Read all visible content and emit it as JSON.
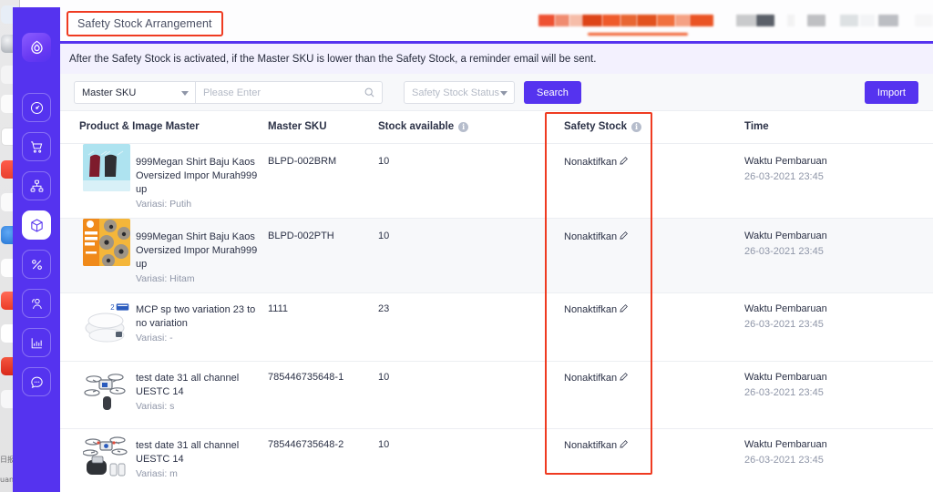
{
  "app": {
    "accent_color": "#5533ef",
    "annotation_color": "#ef3b21",
    "banner_bg": "#f3f1fe"
  },
  "dock": {
    "label_top": "日报",
    "label_bottom": "uan"
  },
  "sidebar": {
    "items": [
      {
        "name": "logo",
        "icon": "leaf-logo-icon",
        "active": false
      },
      {
        "name": "dashboard",
        "icon": "speedometer-icon",
        "active": false
      },
      {
        "name": "orders",
        "icon": "shopping-cart-icon",
        "active": false
      },
      {
        "name": "channels",
        "icon": "sitemap-icon",
        "active": false
      },
      {
        "name": "inventory",
        "icon": "box-icon",
        "active": true
      },
      {
        "name": "promotions",
        "icon": "percent-icon",
        "active": false
      },
      {
        "name": "customers",
        "icon": "users-icon",
        "active": false
      },
      {
        "name": "reports",
        "icon": "bar-chart-icon",
        "active": false
      },
      {
        "name": "messages",
        "icon": "chat-bubble-icon",
        "active": false
      }
    ]
  },
  "header": {
    "title": "Safety Stock Arrangement"
  },
  "notice": {
    "text": "After the Safety Stock is activated, if the Master SKU is lower than the Safety Stock, a reminder email will be sent."
  },
  "filters": {
    "field_select": "Master SKU",
    "search_placeholder": "Please Enter",
    "search_value": "",
    "status_select_placeholder": "Safety Stock Status",
    "search_button": "Search",
    "import_button": "Import"
  },
  "table": {
    "columns": [
      {
        "key": "product",
        "label": "Product & Image Master",
        "info": false
      },
      {
        "key": "sku",
        "label": "Master SKU",
        "info": false
      },
      {
        "key": "stock",
        "label": "Stock available",
        "info": true
      },
      {
        "key": "safety",
        "label": "Safety Stock",
        "info": true
      },
      {
        "key": "time",
        "label": "Time",
        "info": false
      }
    ],
    "variation_prefix": "Variasi:",
    "rows": [
      {
        "product_name": "999Megan Shirt Baju Kaos Oversized Impor Murah999 up",
        "variation": "Putih",
        "thumb": "shirts-on-blue",
        "sku": "BLPD-002BRM",
        "stock": "10",
        "safety_stock": "Nonaktifkan",
        "time_label": "Waktu Pembaruan",
        "time_value": "26-03-2021 23:45"
      },
      {
        "product_name": "999Megan Shirt Baju Kaos Oversized Impor Murah999 up",
        "variation": "Hitam",
        "thumb": "yellow-poster",
        "sku": "BLPD-002PTH",
        "stock": "10",
        "safety_stock": "Nonaktifkan",
        "time_label": "Waktu Pembaruan",
        "time_value": "26-03-2021 23:45"
      },
      {
        "product_name": "MCP sp two variation 23 to no variation",
        "variation": "-",
        "thumb": "pillows",
        "sku": "1111",
        "stock": "23",
        "safety_stock": "Nonaktifkan",
        "time_label": "Waktu Pembaruan",
        "time_value": "26-03-2021 23:45"
      },
      {
        "product_name": "test date 31 all channel UESTC 14",
        "variation": "s",
        "thumb": "drone-white",
        "sku": "785446735648-1",
        "stock": "10",
        "safety_stock": "Nonaktifkan",
        "time_label": "Waktu Pembaruan",
        "time_value": "26-03-2021 23:45"
      },
      {
        "product_name": "test date 31 all channel UESTC 14",
        "variation": "m",
        "thumb": "drone-controller",
        "sku": "785446735648-2",
        "stock": "10",
        "safety_stock": "Nonaktifkan",
        "time_label": "Waktu Pembaruan",
        "time_value": "26-03-2021 23:45"
      }
    ]
  }
}
